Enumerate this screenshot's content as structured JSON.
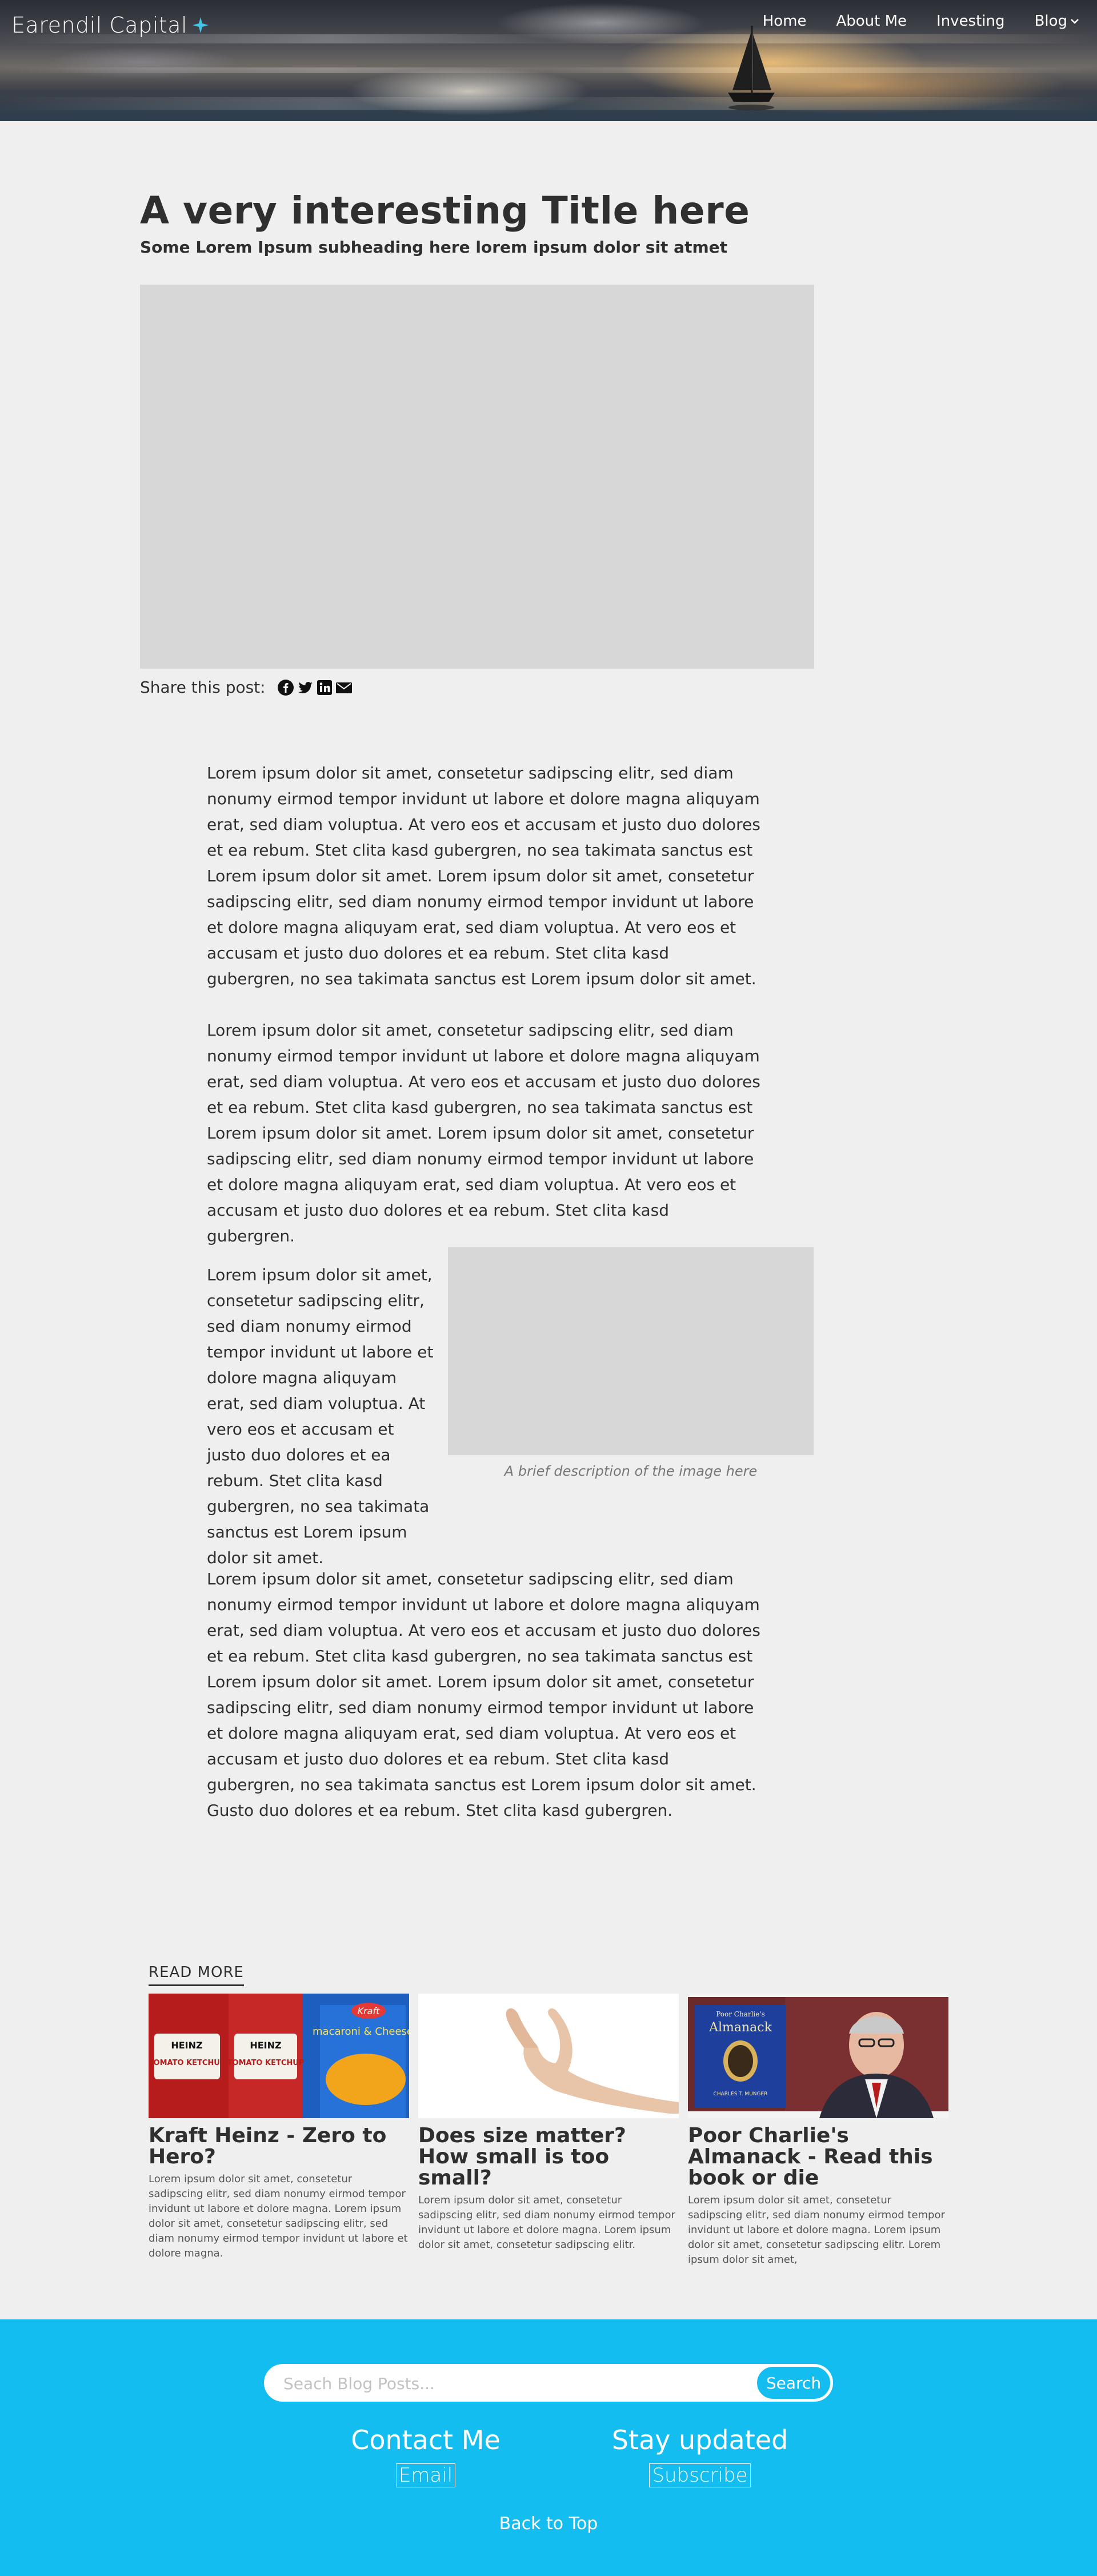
{
  "header": {
    "brand": "Earendil Capital",
    "nav": [
      {
        "label": "Home"
      },
      {
        "label": "About Me"
      },
      {
        "label": "Investing"
      },
      {
        "label": "Blog"
      }
    ]
  },
  "article": {
    "title": "A very interesting Title here",
    "subtitle": "Some Lorem Ipsum subheading here lorem ipsum dolor sit atmet",
    "share_label": "Share this post:",
    "paragraphs": [
      "Lorem ipsum dolor sit amet, consetetur sadipscing elitr, sed diam nonumy eirmod tempor invidunt ut labore et dolore magna aliquyam erat, sed diam voluptua. At vero eos et accusam et justo duo dolores et ea rebum. Stet clita kasd gubergren, no sea takimata sanctus est Lorem ipsum dolor sit amet. Lorem ipsum dolor sit amet, consetetur sadipscing elitr, sed diam nonumy eirmod tempor invidunt ut labore et dolore magna aliquyam erat, sed diam voluptua. At vero eos et accusam et justo duo dolores et ea rebum. Stet clita kasd gubergren, no sea takimata sanctus est Lorem ipsum dolor sit amet.",
      "Lorem ipsum dolor sit amet, consetetur sadipscing elitr, sed diam nonumy eirmod tempor invidunt ut labore et dolore magna aliquyam erat, sed diam voluptua. At vero eos et accusam et justo duo dolores et ea rebum. Stet clita kasd gubergren, no sea takimata sanctus est Lorem ipsum dolor sit amet. Lorem ipsum dolor sit amet, consetetur sadipscing elitr, sed diam nonumy eirmod tempor invidunt ut labore et dolore magna aliquyam erat, sed diam voluptua. At vero eos et accusam et justo duo dolores et ea rebum. Stet clita kasd gubergren.",
      "Lorem ipsum dolor sit amet, consetetur sadipscing elitr, sed diam nonumy eirmod tempor invidunt ut labore et dolore magna aliquyam erat, sed diam voluptua. At vero eos et accusam et justo duo dolores et ea rebum. Stet clita kasd gubergren, no sea takimata sanctus est Lorem ipsum dolor sit amet.",
      "Lorem ipsum dolor sit amet, consetetur sadipscing elitr, sed diam nonumy eirmod tempor invidunt ut labore et dolore magna aliquyam erat, sed diam voluptua. At vero eos et accusam et justo duo dolores et ea rebum. Stet clita kasd gubergren, no sea takimata sanctus est Lorem ipsum dolor sit amet. Lorem ipsum dolor sit amet, consetetur sadipscing elitr, sed diam nonumy eirmod tempor invidunt ut labore et dolore magna aliquyam erat, sed diam voluptua. At vero eos et accusam et justo duo dolores et ea rebum. Stet clita kasd gubergren, no sea takimata sanctus est Lorem ipsum dolor sit amet. Gusto duo dolores et ea rebum. Stet clita kasd gubergren."
    ],
    "image_caption": "A brief description of the image here"
  },
  "read_more": {
    "label": "READ MORE",
    "cards": [
      {
        "title": "Kraft Heinz - Zero to Hero?",
        "excerpt": "Lorem ipsum dolor sit amet, consetetur sadipscing elitr, sed diam nonumy eirmod tempor invidunt ut labore et dolore magna. Lorem ipsum dolor sit amet, consetetur sadipscing elitr, sed diam nonumy eirmod tempor invidunt ut labore et dolore magna.",
        "image_text": [
          "HEINZ",
          "TOMATO KETCHUP",
          "HEINZ",
          "TOMATO KETCHUP",
          "Kraft",
          "macaroni & Cheese"
        ]
      },
      {
        "title": "Does size matter? How small is too small?",
        "excerpt": "Lorem ipsum dolor sit amet, consetetur sadipscing elitr, sed diam nonumy eirmod tempor invidunt ut labore et dolore magna. Lorem ipsum dolor sit amet, consetetur sadipscing elitr."
      },
      {
        "title": "Poor Charlie's Almanack - Read this book or die",
        "excerpt": "Lorem ipsum dolor sit amet, consetetur sadipscing elitr, sed diam nonumy eirmod tempor invidunt ut labore et dolore magna. Lorem ipsum dolor sit amet, consetetur sadipscing elitr. Lorem ipsum dolor sit amet,",
        "image_text": [
          "Poor Charlie's",
          "Almanack",
          "CHARLES T. MUNGER"
        ]
      }
    ]
  },
  "footer": {
    "search_placeholder": "Seach Blog Posts...",
    "search_button": "Search",
    "contact_heading": "Contact Me",
    "contact_link": "Email",
    "updates_heading": "Stay updated",
    "updates_link": "Subscribe",
    "back_to_top": "Back to Top"
  },
  "colors": {
    "footer_bg": "#14bdf0",
    "page_bg": "#efefef",
    "placeholder_gray": "#d7d7d7",
    "brand_star": "#3fc6e8"
  },
  "icons": [
    "sparkle-star-icon",
    "chevron-down-icon",
    "facebook-icon",
    "twitter-icon",
    "linkedin-icon",
    "mail-icon"
  ]
}
